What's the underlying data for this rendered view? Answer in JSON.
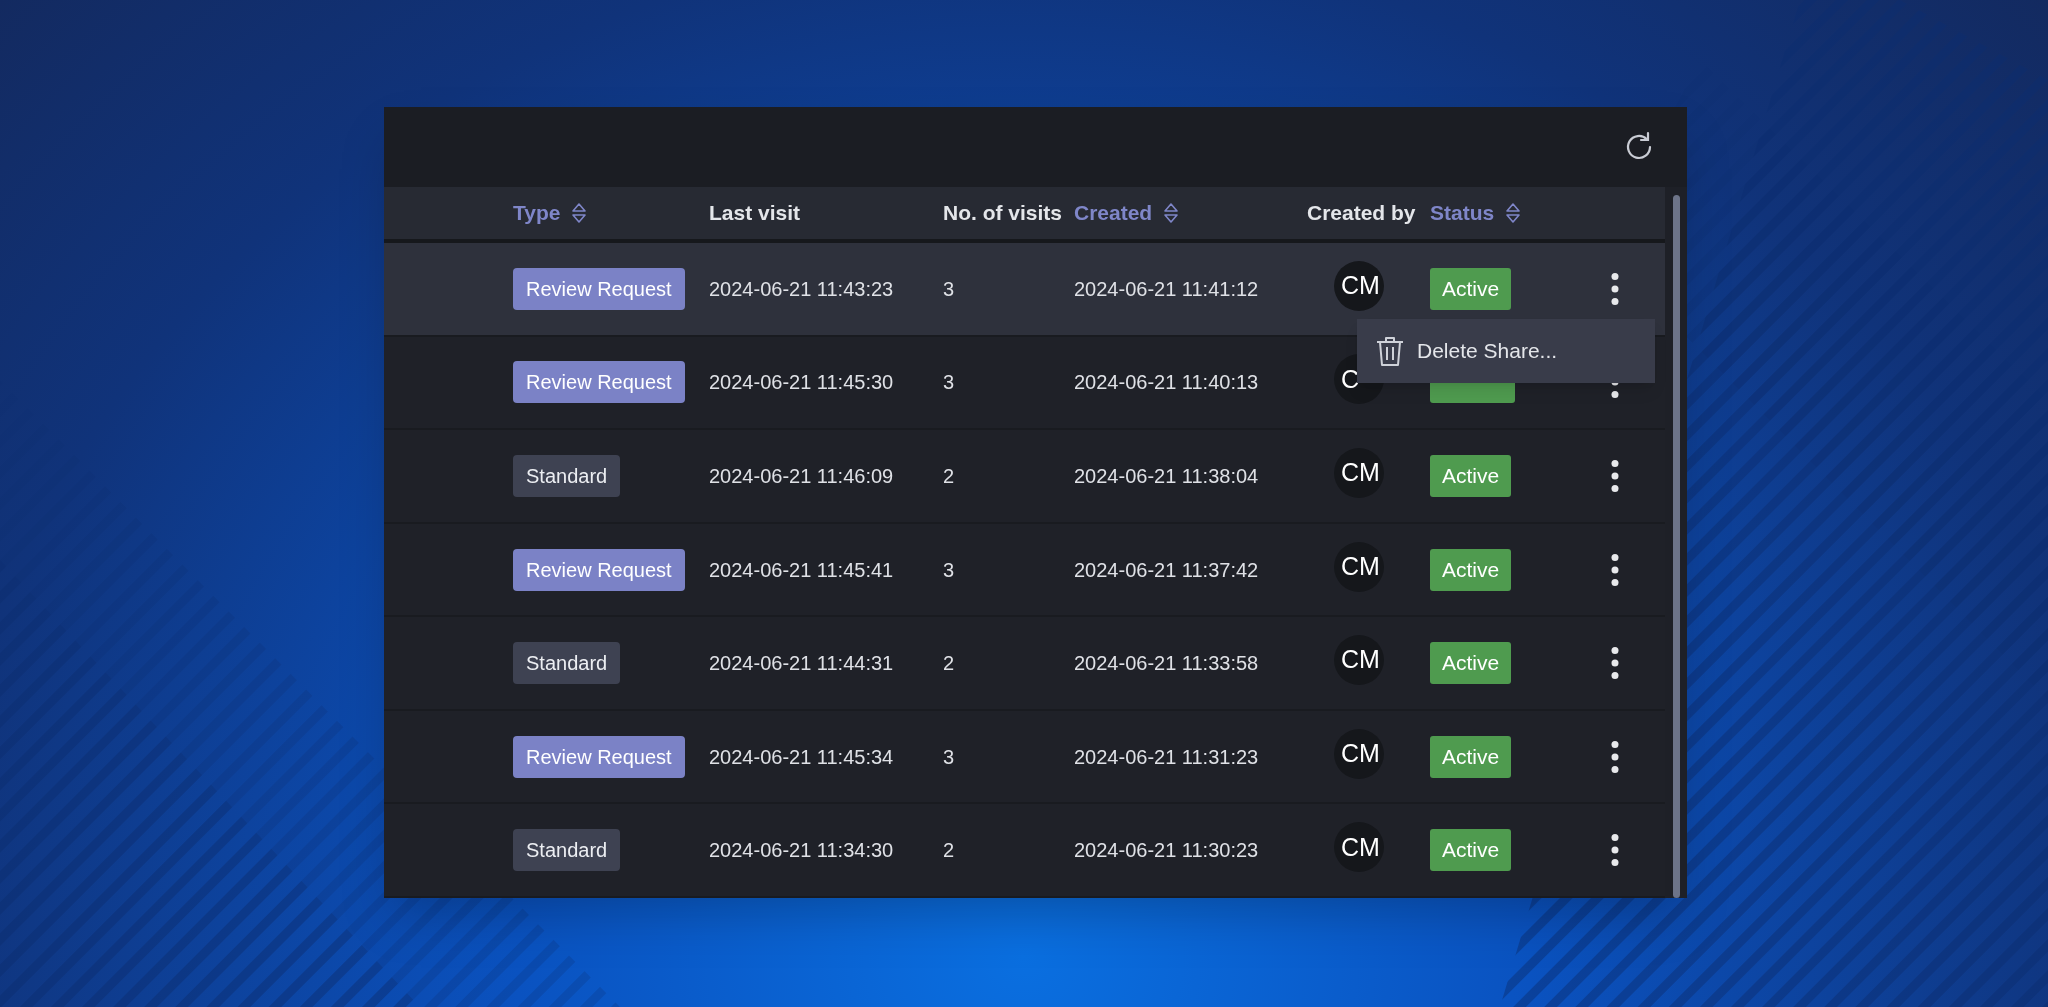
{
  "columns": [
    {
      "label": "Type",
      "sortable": true
    },
    {
      "label": "Last visit",
      "sortable": false
    },
    {
      "label": "No. of visits",
      "sortable": false
    },
    {
      "label": "Created",
      "sortable": true
    },
    {
      "label": "Created by",
      "sortable": false
    },
    {
      "label": "Status",
      "sortable": true
    }
  ],
  "rows": [
    {
      "type": {
        "label": "Review Request",
        "kind": "review"
      },
      "last_visit": "2024-06-21 11:43:23",
      "visits": "3",
      "created": "2024-06-21 11:41:12",
      "created_by": "CM",
      "status": "Active",
      "selected": true,
      "menu": {
        "items": [
          {
            "label": "Delete Share..."
          }
        ]
      }
    },
    {
      "type": {
        "label": "Review Request",
        "kind": "review"
      },
      "last_visit": "2024-06-21 11:45:30",
      "visits": "3",
      "created": "2024-06-21 11:40:13",
      "created_by": "C",
      "selected": false
    },
    {
      "type": {
        "label": "Standard",
        "kind": "standard"
      },
      "last_visit": "2024-06-21 11:46:09",
      "visits": "2",
      "created": "2024-06-21 11:38:04",
      "created_by": "CM",
      "status": "Active",
      "selected": false
    },
    {
      "type": {
        "label": "Review Request",
        "kind": "review"
      },
      "last_visit": "2024-06-21 11:45:41",
      "visits": "3",
      "created": "2024-06-21 11:37:42",
      "created_by": "CM",
      "status": "Active",
      "selected": false
    },
    {
      "type": {
        "label": "Standard",
        "kind": "standard"
      },
      "last_visit": "2024-06-21 11:44:31",
      "visits": "2",
      "created": "2024-06-21 11:33:58",
      "created_by": "CM",
      "status": "Active",
      "selected": false
    },
    {
      "type": {
        "label": "Review Request",
        "kind": "review"
      },
      "last_visit": "2024-06-21 11:45:34",
      "visits": "3",
      "created": "2024-06-21 11:31:23",
      "created_by": "CM",
      "status": "Active",
      "selected": false
    },
    {
      "type": {
        "label": "Standard",
        "kind": "standard"
      },
      "last_visit": "2024-06-21 11:34:30",
      "visits": "2",
      "created": "2024-06-21 11:30:23",
      "created_by": "CM",
      "status": "Active",
      "selected": false
    }
  ]
}
